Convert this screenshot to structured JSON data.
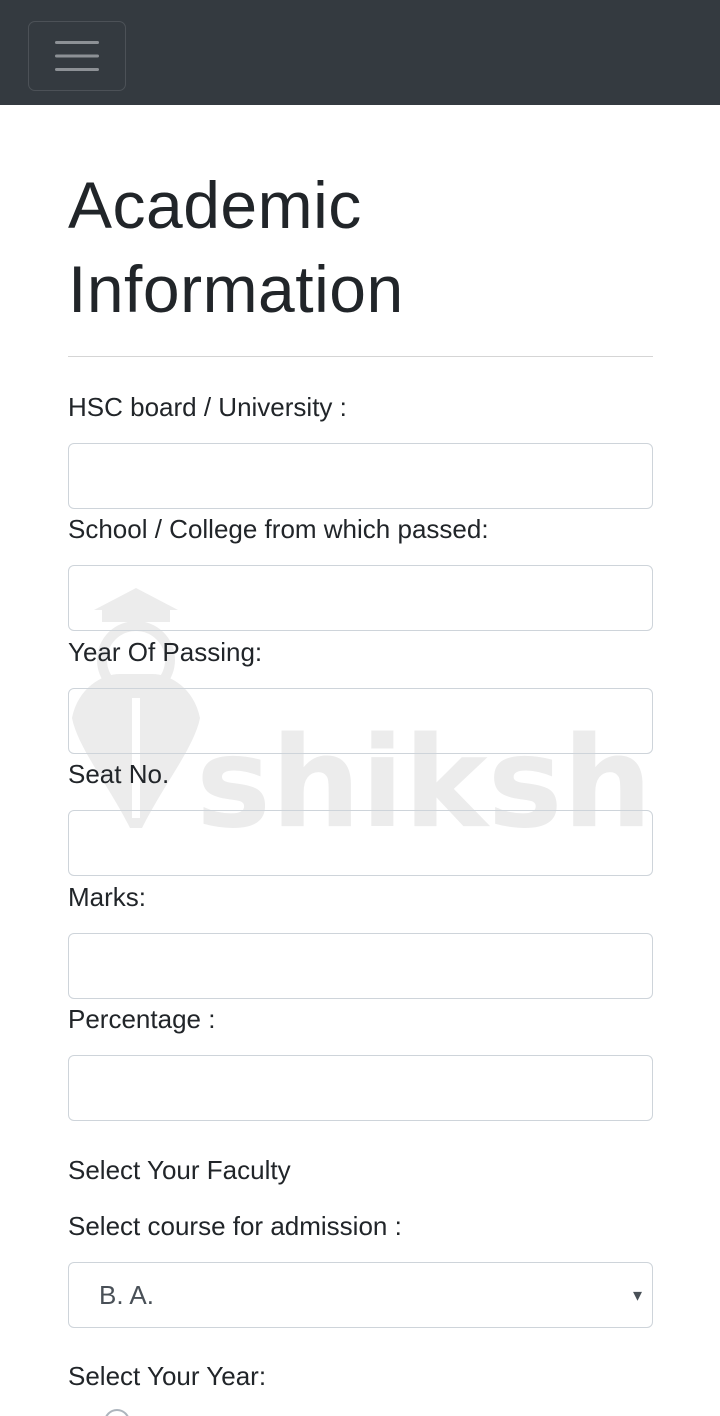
{
  "navbar": {
    "toggle_icon": "hamburger-menu-icon",
    "background": "#343a40"
  },
  "page": {
    "title": "Academic Information"
  },
  "form": {
    "hsc_board": {
      "label": "HSC board / University :",
      "value": ""
    },
    "school_college": {
      "label": "School / College from which passed:",
      "value": ""
    },
    "year_of_passing": {
      "label": "Year Of Passing:",
      "value": ""
    },
    "seat_no": {
      "label": "Seat No.",
      "value": ""
    },
    "marks": {
      "label": "Marks:",
      "value": ""
    },
    "percentage": {
      "label": "Percentage :",
      "value": ""
    },
    "faculty": {
      "label": "Select Your Faculty"
    },
    "course": {
      "label": "Select course for admission :",
      "selected": "B. A."
    },
    "year": {
      "label": "Select Your Year:"
    }
  },
  "watermark": {
    "text": "shiksha",
    "icon": "graduation-pen-logo-icon"
  }
}
